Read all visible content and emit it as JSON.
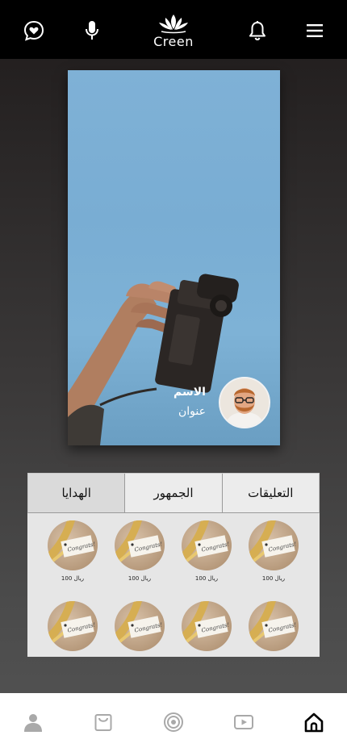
{
  "header": {
    "logo_text": "Creen",
    "icons": [
      "chat-heart-icon",
      "microphone-icon",
      "bell-icon",
      "menu-icon"
    ]
  },
  "live": {
    "poster_name": "الاسم",
    "poster_subtitle": "عنوان"
  },
  "tabs": [
    {
      "label": "التعليقات",
      "active": false
    },
    {
      "label": "الجمهور",
      "active": false
    },
    {
      "label": "الهدايا",
      "active": true
    }
  ],
  "gifts": [
    {
      "price": "100 ريال"
    },
    {
      "price": "100 ريال"
    },
    {
      "price": "100 ريال"
    },
    {
      "price": "100 ريال"
    },
    {
      "price": ""
    },
    {
      "price": ""
    },
    {
      "price": ""
    },
    {
      "price": ""
    }
  ],
  "gift_card_text": "Congrats!",
  "bottom_nav": [
    "profile-icon",
    "shop-bag-icon",
    "target-icon",
    "video-play-icon",
    "home-icon"
  ],
  "colors": {
    "topbar": "#000000",
    "sky": "#7fb1d6",
    "panel": "#e6e6e6",
    "active_tab": "#dadada"
  }
}
